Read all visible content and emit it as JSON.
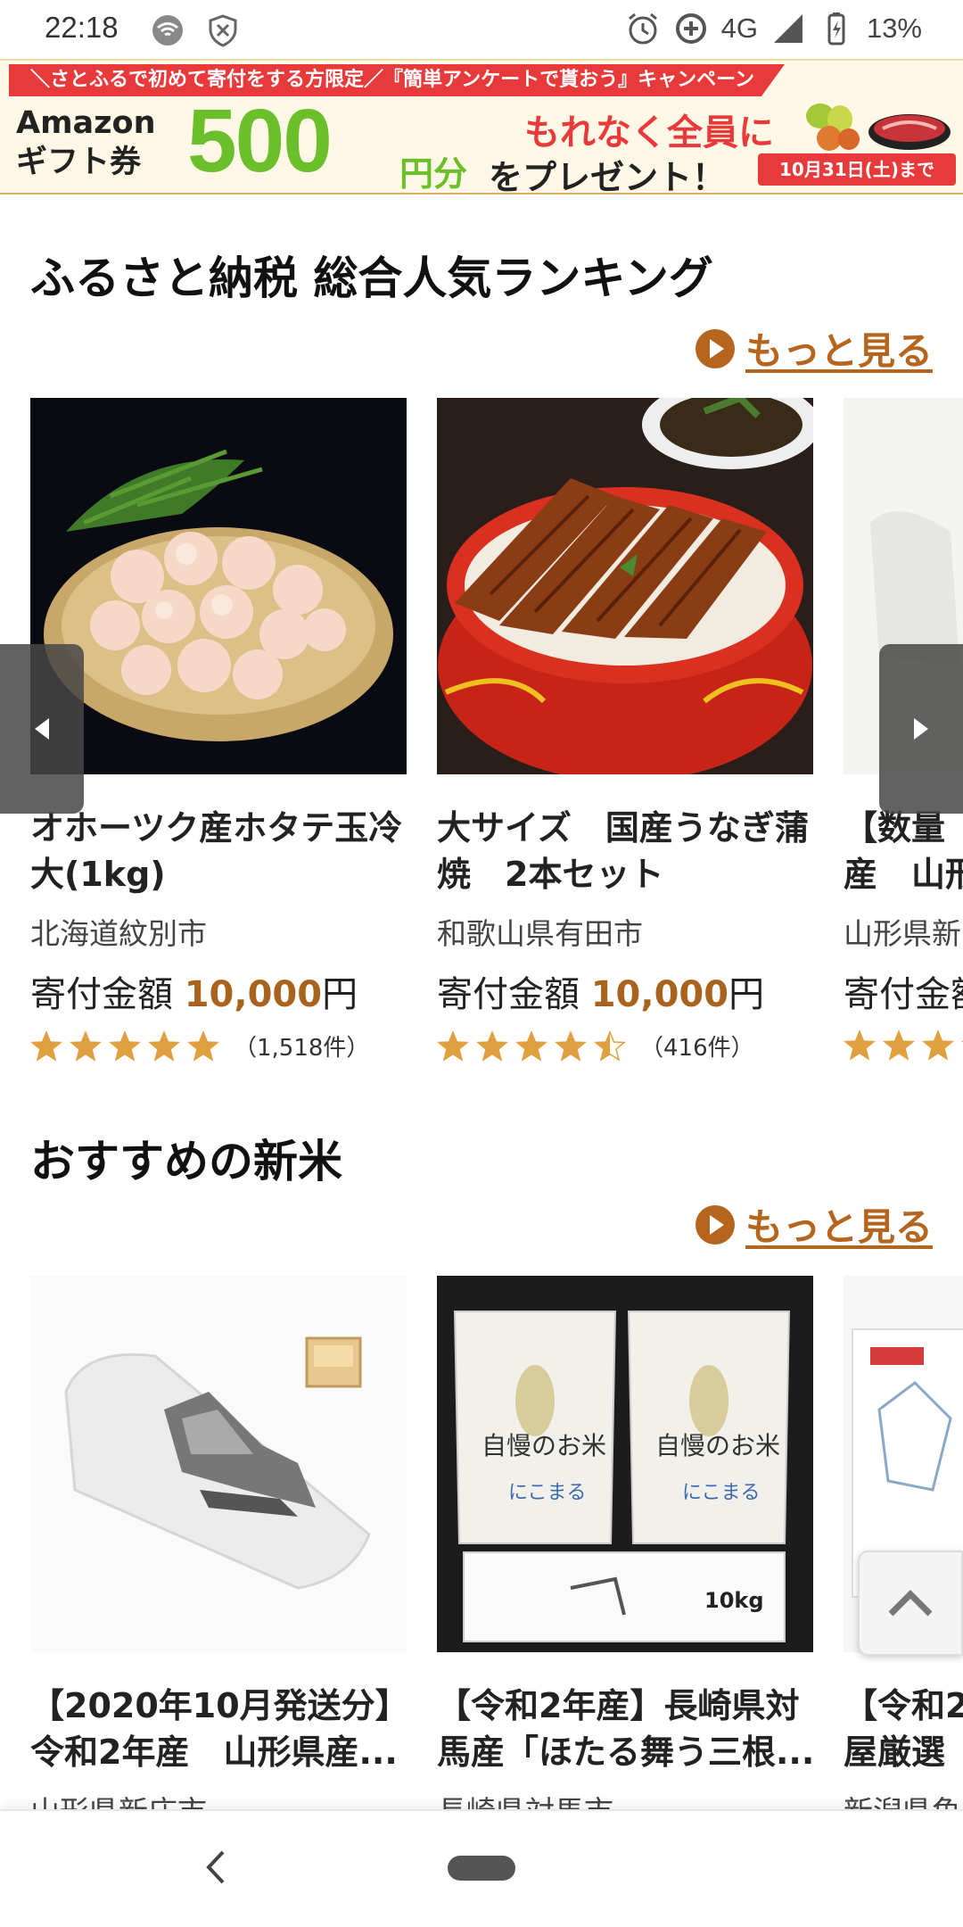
{
  "status_bar": {
    "time": "22:18",
    "network": "4G",
    "battery": "13%",
    "icons": [
      "wifi-off-icon",
      "shield-icon",
      "alarm-icon",
      "data-saver-icon",
      "signal-icon",
      "battery-charging-icon"
    ]
  },
  "banner": {
    "top_text": "＼さとふるで初めて寄付をする方限定／『簡単アンケートで貰おう』キャンペーン",
    "amazon_line1": "Amazon",
    "amazon_line2": "ギフト券",
    "amount": "500",
    "amount_unit": "円分",
    "line1": "もれなく全員に",
    "line2": "をプレゼント！",
    "date": "10月31日(土)まで",
    "colors": {
      "red": "#e83a3a",
      "green": "#6bbf2a"
    }
  },
  "ranking": {
    "title": "ふるさと納税 総合人気ランキング",
    "more_label": "もっと見る",
    "items": [
      {
        "title_line1": "オホーツク産ホタテ玉冷",
        "title_line2": "大(1kg)",
        "city": "北海道紋別市",
        "price_label": "寄付金額 ",
        "price": "10,000",
        "price_unit": "円",
        "rating": 5,
        "review_count": "（1,518件）"
      },
      {
        "title_line1": "大サイズ　国産うなぎ蒲",
        "title_line2": "焼　2本セット",
        "city": "和歌山県有田市",
        "price_label": "寄付金額 ",
        "price": "10,000",
        "price_unit": "円",
        "rating": 4.5,
        "review_count": "（416件）"
      },
      {
        "title_line1": "【数量",
        "title_line2": "産　山形",
        "city": "山形県新",
        "price_label": "寄付金額",
        "price": "",
        "price_unit": "",
        "rating": 3,
        "review_count": ""
      }
    ]
  },
  "new_rice": {
    "title": "おすすめの新米",
    "more_label": "もっと見る",
    "items": [
      {
        "title_line1": "【2020年10月発送分】",
        "title_line2": "令和2年産　山形県産...",
        "city": "山形県新庄市"
      },
      {
        "title_line1": "【令和2年産】長崎県対",
        "title_line2": "馬産「ほたる舞う三根...",
        "city": "長崎県対馬市",
        "bag_text": "自慢のお米",
        "bag_brand": "にこまる",
        "box_label": "10kg"
      },
      {
        "title_line1": "【令和2",
        "title_line2": "屋厳選",
        "city": "新潟県魚"
      }
    ]
  },
  "accent_color": "#b5651d"
}
